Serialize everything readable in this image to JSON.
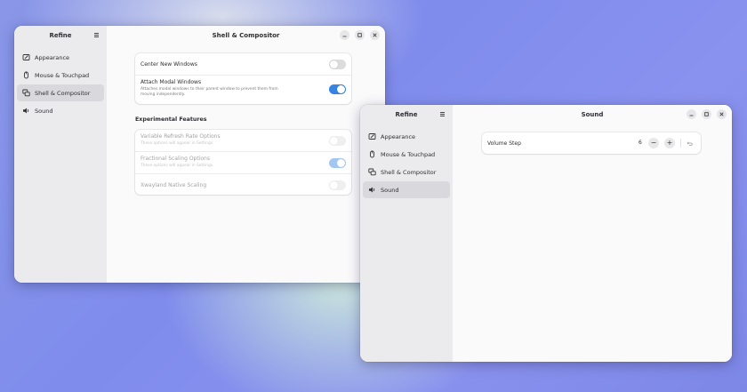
{
  "colors": {
    "accent": "#3584e4",
    "sidebar_bg": "#ebebed",
    "active_item": "#d9d9dd",
    "content_bg": "#fafafb"
  },
  "window_left": {
    "sidebar": {
      "title": "Refine",
      "menu_icon": "hamburger-icon",
      "items": [
        {
          "label": "Appearance",
          "icon": "appearance-icon",
          "active": false
        },
        {
          "label": "Mouse & Touchpad",
          "icon": "mouse-icon",
          "active": false
        },
        {
          "label": "Shell & Compositor",
          "icon": "windows-icon",
          "active": true
        },
        {
          "label": "Sound",
          "icon": "speaker-icon",
          "active": false
        }
      ]
    },
    "title": "Shell & Compositor",
    "group1": [
      {
        "title": "Center New Windows",
        "enabled": false
      },
      {
        "title": "Attach Modal Windows",
        "subtitle_line1": "Attaches modal windows to their parent window to prevent them from",
        "subtitle_line2": "moving independently.",
        "enabled": true
      }
    ],
    "section_title": "Experimental Features",
    "group2": [
      {
        "title": "Variable Refresh Rate Options",
        "subtitle": "These options will appear in Settings.",
        "enabled": false,
        "sensitive": false
      },
      {
        "title": "Fractional Scaling Options",
        "subtitle": "These options will appear in Settings.",
        "enabled": true,
        "sensitive": false
      },
      {
        "title": "Xwayland Native Scaling",
        "enabled": false,
        "sensitive": false
      }
    ]
  },
  "window_right": {
    "sidebar": {
      "title": "Refine",
      "menu_icon": "hamburger-icon",
      "items": [
        {
          "label": "Appearance",
          "icon": "appearance-icon",
          "active": false
        },
        {
          "label": "Mouse & Touchpad",
          "icon": "mouse-icon",
          "active": false
        },
        {
          "label": "Shell & Compositor",
          "icon": "windows-icon",
          "active": false
        },
        {
          "label": "Sound",
          "icon": "speaker-icon",
          "active": true
        }
      ]
    },
    "title": "Sound",
    "volume_step": {
      "label": "Volume Step",
      "value": "6",
      "minus": "−",
      "plus": "+"
    }
  }
}
